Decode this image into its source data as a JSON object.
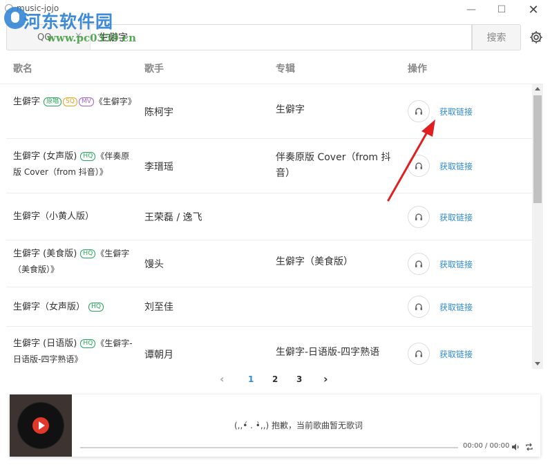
{
  "window": {
    "title": "music-jojo",
    "controls": {
      "minimize": "—",
      "maximize": "☐",
      "close": "✕"
    }
  },
  "watermark": {
    "title": "河东软件园",
    "url": "www.pc0359.cn"
  },
  "search": {
    "source_label": "QQ",
    "source_clear": "✕",
    "query": "生僻字",
    "button_label": "搜索"
  },
  "table": {
    "headers": {
      "name": "歌名",
      "singer": "歌手",
      "album": "专辑",
      "action": "操作"
    },
    "rows": [
      {
        "name": "生僻字",
        "tags": [
          "原唱",
          "SQ",
          "MV"
        ],
        "subtitle": "《生僻字》",
        "singer": "陈柯宇",
        "album": "生僻字",
        "action": "获取链接"
      },
      {
        "name": "生僻字 (女声版)",
        "tags": [
          "HQ"
        ],
        "subtitle": "《伴奏原版 Cover（from 抖音）》",
        "singer": "李瑨瑶",
        "album": "伴奏原版 Cover（from 抖音）",
        "action": "获取链接"
      },
      {
        "name": "生僻字（小黄人版）",
        "tags": [],
        "subtitle": "",
        "singer": "王荣磊 / 逸飞",
        "album": "",
        "action": "获取链接"
      },
      {
        "name": "生僻字 (美食版)",
        "tags": [
          "HQ"
        ],
        "subtitle": "《生僻字（美食版）》",
        "singer": "馒头",
        "album": "生僻字（美食版）",
        "action": "获取链接"
      },
      {
        "name": "生僻字（女声版）",
        "tags": [
          "HQ"
        ],
        "subtitle": "",
        "singer": "刘至佳",
        "album": "",
        "action": "获取链接"
      },
      {
        "name": "生僻字 (日语版)",
        "tags": [
          "HQ"
        ],
        "subtitle": "《生僻字-日语版-四字熟语》",
        "singer": "谭朝月",
        "album": "生僻字-日语版-四字熟语",
        "action": "获取链接"
      }
    ]
  },
  "pagination": {
    "prev": "‹",
    "pages": [
      "1",
      "2",
      "3"
    ],
    "active_page": "1",
    "next": "›"
  },
  "player": {
    "lyric_message": "(,,•́ . •̀,,) 抱歉，当前歌曲暂无歌词",
    "time": "00:00 / 00:00",
    "progress": 0
  },
  "colors": {
    "link": "#2f8bd8",
    "tag_green": "#26a65b",
    "tag_orange": "#e6a21c",
    "tag_purple": "#a25fd0",
    "annotation_arrow": "#e02020",
    "play_button": "#e0392b"
  },
  "icons": {
    "settings": "gear-icon",
    "listen": "headphones-icon",
    "volume": "speaker-icon",
    "loop": "repeat-icon"
  }
}
